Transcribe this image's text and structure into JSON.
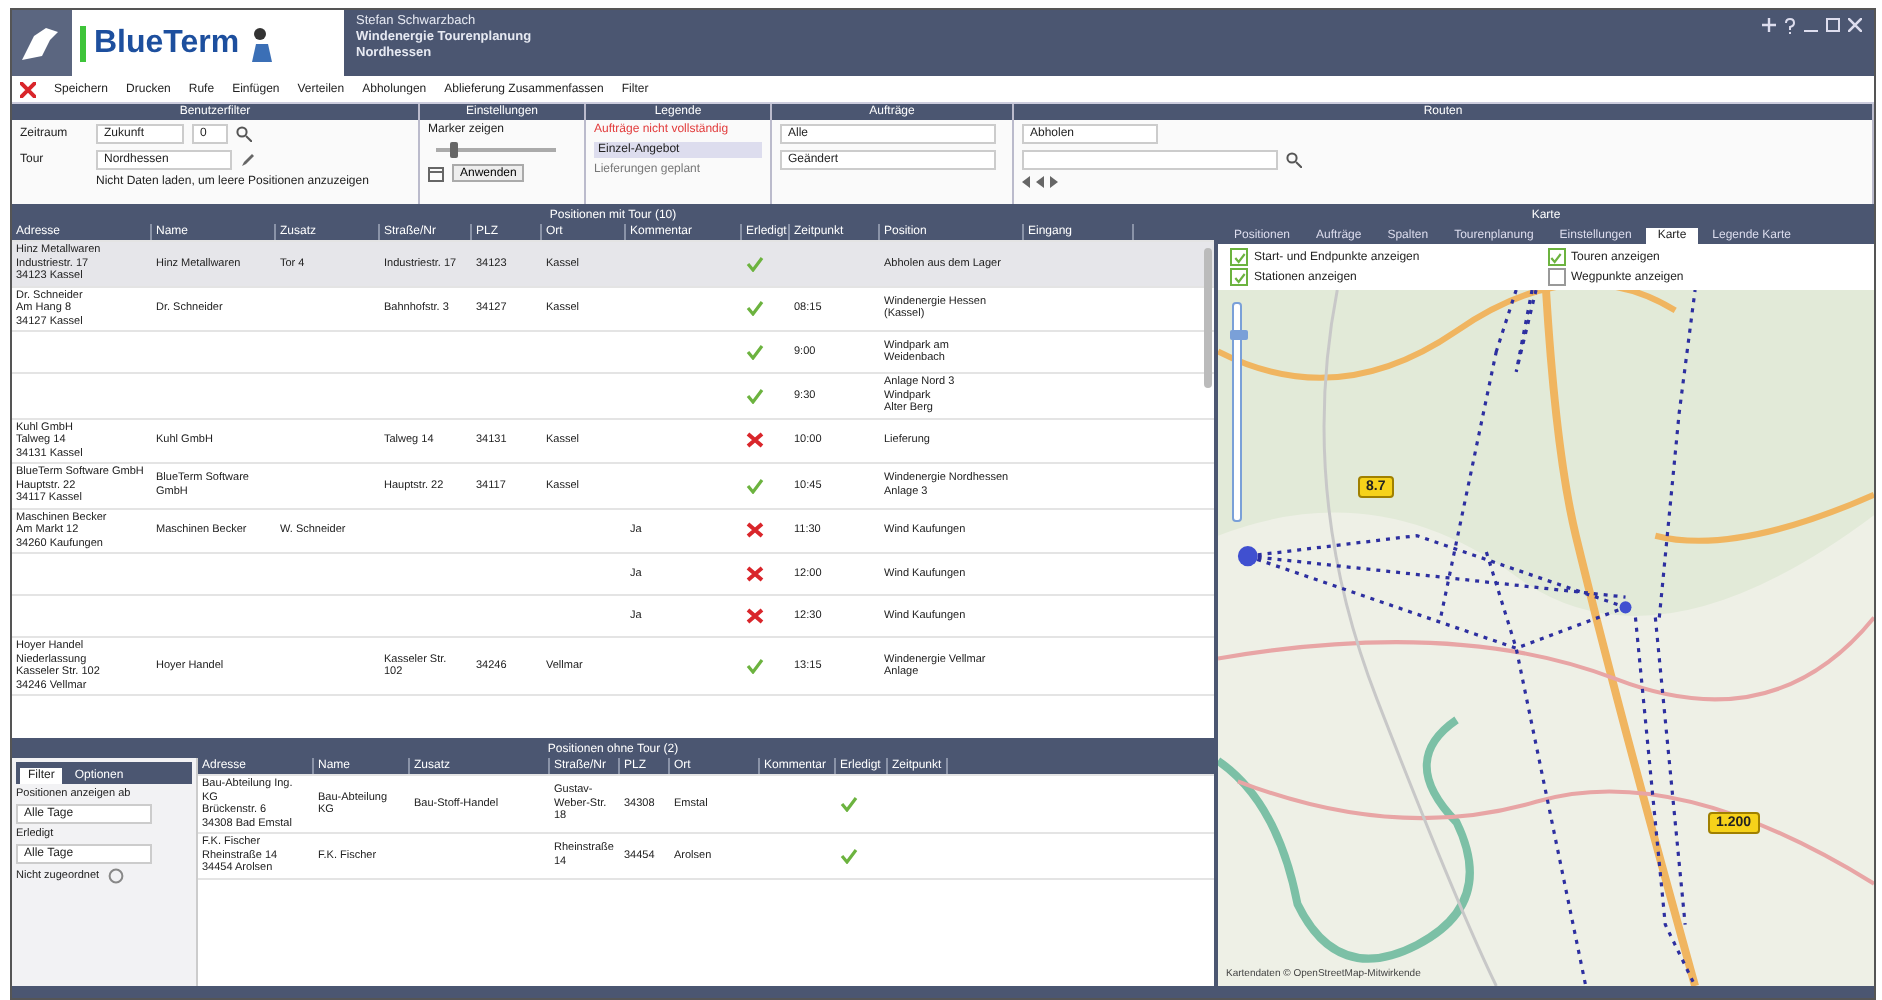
{
  "header": {
    "logo": "BlueTerm",
    "title_lines": [
      "Stefan Schwarzbach",
      "Windenergie Tourenplanung",
      "Nordhessen"
    ]
  },
  "menu": [
    "Speichern",
    "Drucken",
    "Rufe",
    "Einfügen",
    "Verteilen",
    "Abholungen",
    "Ablieferung Zusammenfassen",
    "Filter"
  ],
  "filters": {
    "panels": [
      "Benutzerfilter",
      "Einstellungen",
      "Legende",
      "Aufträge",
      "Routen"
    ],
    "user": {
      "label_1": "Zeitraum",
      "value_1": "Zukunft",
      "num": "0",
      "label_2": "Tour",
      "value_2": "Nordhessen",
      "hint": "Nicht Daten laden, um leere Positionen anzuzeigen"
    },
    "settings": {
      "label": "Marker zeigen",
      "level": 0.15,
      "button": "Anwenden"
    },
    "legend": [
      "Aufträge nicht vollständig",
      "Einzel-Angebot",
      "Lieferungen geplant"
    ],
    "orders": [
      "Alle",
      "Geändert"
    ],
    "routes": {
      "value": "Abholen"
    }
  },
  "table": {
    "title": "Positionen mit Tour (10)",
    "columns": [
      "Adresse",
      "Name",
      "Zusatz",
      "Straße/Nr",
      "PLZ",
      "Ort",
      "Kommentar",
      "Erledigt",
      "Zeitpunkt",
      "Position",
      "Eingang"
    ],
    "rows": [
      {
        "selected": true,
        "done": true,
        "cells": [
          "Hinz Metallwaren\nIndustriestr. 17\n34123 Kassel",
          "Hinz Metallwaren",
          "Tor 4",
          "Industriestr. 17",
          "34123",
          "Kassel",
          "",
          "",
          "",
          "Abholen aus dem Lager",
          ""
        ]
      },
      {
        "selected": false,
        "done": true,
        "cells": [
          "Dr. Schneider\nAm Hang 8\n34127 Kassel",
          "Dr. Schneider",
          "",
          "Bahnhofstr. 3",
          "34127",
          "Kassel",
          "",
          "",
          "08:15",
          "Windenergie Hessen\n(Kassel)",
          ""
        ]
      },
      {
        "selected": false,
        "done": true,
        "cells": [
          "",
          "",
          "",
          "",
          "",
          "",
          "",
          "",
          "9:00",
          "Windpark am\nWeidenbach",
          ""
        ]
      },
      {
        "selected": false,
        "done": true,
        "cells": [
          "",
          "",
          "",
          "",
          "",
          "",
          "",
          "",
          "9:30",
          "Anlage Nord 3\nWindpark\nAlter Berg",
          ""
        ]
      },
      {
        "selected": false,
        "done": false,
        "cells": [
          "Kuhl GmbH\nTalweg 14\n34131 Kassel",
          "Kuhl GmbH",
          "",
          "Talweg 14",
          "34131",
          "Kassel",
          "",
          "",
          "10:00",
          "Lieferung",
          ""
        ]
      },
      {
        "selected": false,
        "done": true,
        "cells": [
          "BlueTerm Software GmbH\nHauptstr. 22\n34117 Kassel",
          "BlueTerm Software GmbH",
          "",
          "Hauptstr. 22",
          "34117",
          "Kassel",
          "",
          "",
          "10:45",
          "Windenergie Nordhessen\nAnlage 3",
          ""
        ]
      },
      {
        "selected": false,
        "done": false,
        "cells": [
          "Maschinen Becker\nAm Markt 12\n34260 Kaufungen",
          "Maschinen Becker",
          "W. Schneider",
          "",
          "",
          "",
          "Ja",
          "",
          "11:30",
          "Wind Kaufungen",
          ""
        ]
      },
      {
        "selected": false,
        "done": false,
        "cells": [
          "",
          "",
          "",
          "",
          "",
          "",
          "Ja",
          "",
          "12:00",
          "Wind Kaufungen",
          ""
        ]
      },
      {
        "selected": false,
        "done": false,
        "cells": [
          "",
          "",
          "",
          "",
          "",
          "",
          "Ja",
          "",
          "12:30",
          "Wind Kaufungen",
          ""
        ]
      },
      {
        "selected": false,
        "done": true,
        "cells": [
          "Hoyer Handel\nNiederlassung\nKasseler Str. 102\n34246 Vellmar",
          "Hoyer Handel",
          "",
          "Kasseler Str.\n102",
          "34246",
          "Vellmar",
          "",
          "",
          "13:15",
          "Windenergie Vellmar\nAnlage",
          ""
        ]
      }
    ]
  },
  "map": {
    "title": "Karte",
    "tabs": [
      {
        "label": "Positionen",
        "selected": false
      },
      {
        "label": "Aufträge",
        "selected": false
      },
      {
        "label": "Spalten",
        "selected": false
      },
      {
        "label": "Tourenplanung",
        "selected": false
      },
      {
        "label": "Einstellungen",
        "selected": false
      },
      {
        "label": "Karte",
        "selected": true
      },
      {
        "label": "Legende Karte",
        "selected": false
      }
    ],
    "options": [
      {
        "label": "Start- und Endpunkte anzeigen",
        "checked": true
      },
      {
        "label": "Touren anzeigen",
        "checked": true
      },
      {
        "label": "Stationen anzeigen",
        "checked": true
      },
      {
        "label": "Wegpunkte anzeigen",
        "checked": false
      }
    ],
    "zoom": {
      "level": 0.85
    },
    "markers": [
      {
        "label": "8.7"
      },
      {
        "label": "1.200"
      }
    ],
    "attribution": "Kartendaten © OpenStreetMap-Mitwirkende"
  },
  "bottom": {
    "title": "Positionen ohne Tour (2)",
    "side_tabs": [
      {
        "label": "Filter",
        "selected": true
      },
      {
        "label": "Optionen",
        "selected": false
      }
    ],
    "side_fields": [
      {
        "label": "Positionen anzeigen ab",
        "value": "Alle Tage"
      },
      {
        "label": "Erledigt",
        "value": "Alle Tage"
      }
    ],
    "side_toggle": "Nicht zugeordnet",
    "columns": [
      "Adresse",
      "Name",
      "Zusatz",
      "Straße/Nr",
      "PLZ",
      "Ort",
      "Kommentar",
      "Erledigt",
      "Zeitpunkt"
    ],
    "rows": [
      {
        "done": true,
        "cells": [
          "Bau-Abteilung Ing. KG\nBrückenstr. 6\n34308 Bad Emstal",
          "Bau-Abteilung KG",
          "Bau-Stoff-Handel",
          "Gustav-Weber-Str. 18",
          "34308",
          "Emstal",
          "",
          "",
          ""
        ]
      },
      {
        "done": true,
        "cells": [
          "F.K. Fischer\nRheinstraße 14\n34454 Arolsen",
          "F.K. Fischer",
          "",
          "Rheinstraße 14",
          "34454",
          "Arolsen",
          "",
          "",
          ""
        ]
      }
    ]
  }
}
